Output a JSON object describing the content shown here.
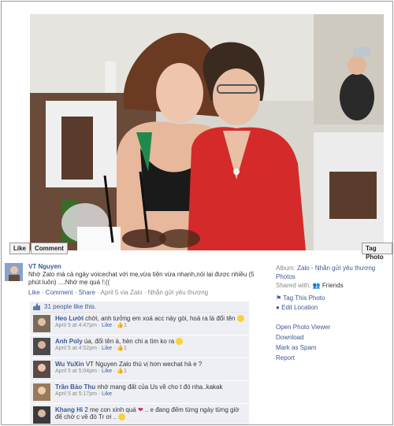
{
  "photo_buttons": {
    "like": "Like",
    "comment": "Comment",
    "tag_photo": "Tag Photo"
  },
  "post": {
    "author": "VT Nguyen",
    "text": "Nhờ Zalo mà cả ngày voicechat với mẹ,vừa tiện vừa nhanh,nói lại được nhiều (5 phút luôn) ....Nhớ mẹ quá !:((",
    "actions": {
      "like": "Like",
      "comment": "Comment",
      "share": "Share",
      "meta": "· April 5 via Zalo · Nhắn gửi yêu thương"
    }
  },
  "likes": {
    "text": "31 people like this."
  },
  "comments": [
    {
      "name": "Heo Lười",
      "text": "chời, anh tưởng em xoá acc này gòi, hoá ra là đổi tên",
      "time": "April 5 at 4:47pm",
      "like": "Like",
      "count": "1"
    },
    {
      "name": "Anh Poly",
      "text": "úa, đổi tên à, hèn chi a tìm ko ra",
      "time": "April 5 at 4:52pm",
      "like": "Like",
      "count": "1"
    },
    {
      "name": "Wu YuXin",
      "text": "VT Nguyen Zalo thú vị hơn wechat hả e ?",
      "time": "April 5 at 5:04pm",
      "like": "Like",
      "count": "1"
    },
    {
      "name": "Trần Bảo Thu",
      "text": "nhớ mang đất của Us về cho t đó nha..kakak",
      "time": "April 5 at 5:17pm",
      "like": "Like",
      "count": ""
    },
    {
      "name": "Khang Hi",
      "text": "2 mẹ con xinh quá",
      "text2": ".. e đang đếm từng ngày từng giờ để chờ c về đó Tr ơi ..",
      "time": "",
      "like": "",
      "count": ""
    }
  ],
  "sidebar": {
    "album_label": "Album:",
    "album_value": "Zalo - Nhắn gửi yêu thương Photos",
    "shared_label": "Shared with:",
    "shared_value": "Friends",
    "tag_this_photo": "Tag This Photo",
    "edit_location": "Edit Location",
    "open_viewer": "Open Photo Viewer",
    "download": "Download",
    "mark_spam": "Mark as Spam",
    "report": "Report"
  },
  "colors": {
    "link": "#3b5998",
    "comment_bg": "#edeff4",
    "dress": "#d42a2a"
  }
}
